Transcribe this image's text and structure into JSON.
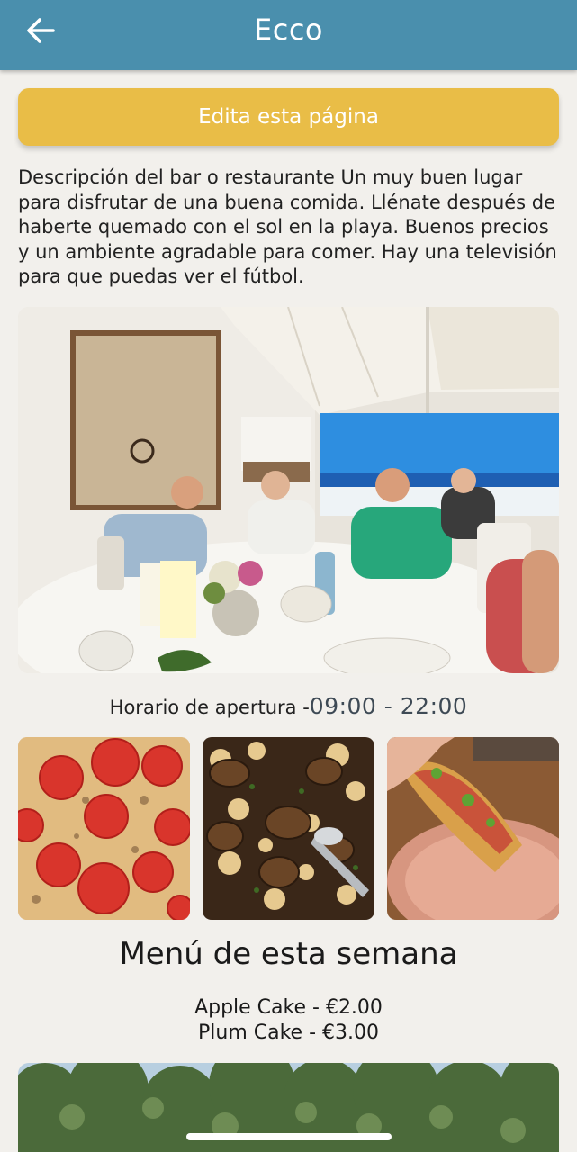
{
  "header": {
    "title": "Ecco",
    "back_icon": "arrow-left-icon",
    "background_color": "#4a8fad"
  },
  "edit_button": {
    "label": "Edita esta página",
    "color": "#e9bd47"
  },
  "description": "Descripción del bar o restaurante Un muy buen lugar para disfrutar de una buena comida. Llénate después de haberte quemado con el sol en la playa. Buenos precios y un ambiente agradable para comer. Hay una televisión para que puedas ver el fútbol.",
  "opening_hours": {
    "label": "Horario de apertura -",
    "time": "09:00 - 22:00"
  },
  "menu": {
    "title": "Menú de esta semana",
    "items": [
      "Apple Cake - €2.00",
      "Plum Cake - €3.00"
    ]
  }
}
